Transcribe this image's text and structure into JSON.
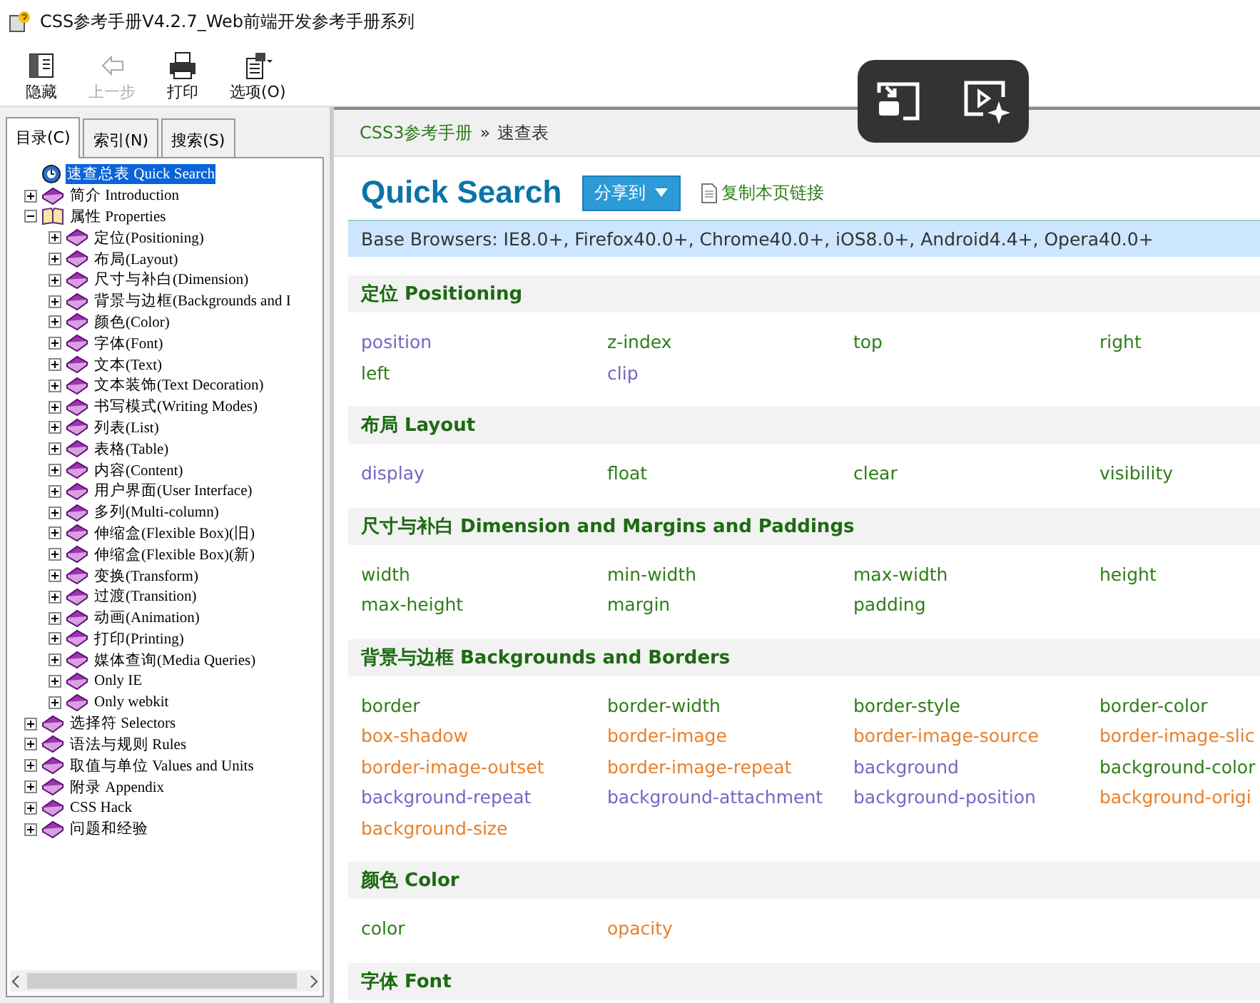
{
  "window": {
    "title": "CSS参考手册V4.2.7_Web前端开发参考手册系列"
  },
  "toolbar": [
    {
      "label": "隐藏",
      "kind": "hide",
      "disabled": false
    },
    {
      "label": "上一步",
      "kind": "back",
      "disabled": true
    },
    {
      "label": "打印",
      "kind": "print",
      "disabled": false
    },
    {
      "label": "选项(O)",
      "kind": "options",
      "disabled": false
    }
  ],
  "nav_tabs": [
    {
      "label": "目录(C)",
      "selected": true
    },
    {
      "label": "索引(N)",
      "selected": false
    },
    {
      "label": "搜索(S)",
      "selected": false
    }
  ],
  "tree": [
    {
      "label": "速查总表 Quick Search",
      "kind": "page",
      "selected": true
    },
    {
      "label": "简介 Introduction",
      "kind": "book",
      "expanded": false,
      "selected": false
    },
    {
      "label": "属性 Properties",
      "kind": "book",
      "expanded": true,
      "selected": false,
      "children": [
        {
          "label": "定位(Positioning)",
          "kind": "book",
          "expanded": false,
          "selected": false
        },
        {
          "label": "布局(Layout)",
          "kind": "book",
          "expanded": false,
          "selected": false
        },
        {
          "label": "尺寸与补白(Dimension)",
          "kind": "book",
          "expanded": false,
          "selected": false
        },
        {
          "label": "背景与边框(Backgrounds and I",
          "kind": "book",
          "expanded": false,
          "selected": false
        },
        {
          "label": "颜色(Color)",
          "kind": "book",
          "expanded": false,
          "selected": false
        },
        {
          "label": "字体(Font)",
          "kind": "book",
          "expanded": false,
          "selected": false
        },
        {
          "label": "文本(Text)",
          "kind": "book",
          "expanded": false,
          "selected": false
        },
        {
          "label": "文本装饰(Text Decoration)",
          "kind": "book",
          "expanded": false,
          "selected": false
        },
        {
          "label": "书写模式(Writing Modes)",
          "kind": "book",
          "expanded": false,
          "selected": false
        },
        {
          "label": "列表(List)",
          "kind": "book",
          "expanded": false,
          "selected": false
        },
        {
          "label": "表格(Table)",
          "kind": "book",
          "expanded": false,
          "selected": false
        },
        {
          "label": "内容(Content)",
          "kind": "book",
          "expanded": false,
          "selected": false
        },
        {
          "label": "用户界面(User Interface)",
          "kind": "book",
          "expanded": false,
          "selected": false
        },
        {
          "label": "多列(Multi-column)",
          "kind": "book",
          "expanded": false,
          "selected": false
        },
        {
          "label": "伸缩盒(Flexible Box)(旧)",
          "kind": "book",
          "expanded": false,
          "selected": false
        },
        {
          "label": "伸缩盒(Flexible Box)(新)",
          "kind": "book",
          "expanded": false,
          "selected": false
        },
        {
          "label": "变换(Transform)",
          "kind": "book",
          "expanded": false,
          "selected": false
        },
        {
          "label": "过渡(Transition)",
          "kind": "book",
          "expanded": false,
          "selected": false
        },
        {
          "label": "动画(Animation)",
          "kind": "book",
          "expanded": false,
          "selected": false
        },
        {
          "label": "打印(Printing)",
          "kind": "book",
          "expanded": false,
          "selected": false
        },
        {
          "label": "媒体查询(Media Queries)",
          "kind": "book",
          "expanded": false,
          "selected": false
        },
        {
          "label": "Only IE",
          "kind": "book",
          "expanded": false,
          "selected": false
        },
        {
          "label": "Only webkit",
          "kind": "book",
          "expanded": false,
          "selected": false
        }
      ]
    },
    {
      "label": "选择符 Selectors",
      "kind": "book",
      "expanded": false,
      "selected": false
    },
    {
      "label": "语法与规则 Rules",
      "kind": "book",
      "expanded": false,
      "selected": false
    },
    {
      "label": "取值与单位 Values and Units",
      "kind": "book",
      "expanded": false,
      "selected": false
    },
    {
      "label": "附录 Appendix",
      "kind": "book",
      "expanded": false,
      "selected": false
    },
    {
      "label": "CSS Hack",
      "kind": "book",
      "expanded": false,
      "selected": false
    },
    {
      "label": "问题和经验",
      "kind": "book",
      "expanded": false,
      "selected": false
    }
  ],
  "breadcrumb": [
    {
      "label": "CSS3参考手册",
      "kind": "link"
    },
    {
      "label": "»",
      "kind": "separator"
    },
    {
      "label": "速查表",
      "kind": "current"
    }
  ],
  "page": {
    "title": "Quick Search",
    "share_button": "分享到",
    "copy_link": "复制本页链接",
    "browsers": "Base Browsers: IE8.0+, Firefox40.0+, Chrome40.0+, iOS8.0+, Android4.4+, Opera40.0+",
    "sections": [
      {
        "title": "定位 Positioning",
        "items": [
          {
            "label": "position",
            "color": "#7566c4"
          },
          {
            "label": "z-index",
            "color": "#2e7d1a"
          },
          {
            "label": "top",
            "color": "#2e7d1a"
          },
          {
            "label": "right",
            "color": "#2e7d1a"
          },
          {
            "label": "left",
            "color": "#2e7d1a"
          },
          {
            "label": "clip",
            "color": "#7566c4"
          }
        ]
      },
      {
        "title": "布局 Layout",
        "items": [
          {
            "label": "display",
            "color": "#7566c4"
          },
          {
            "label": "float",
            "color": "#2e7d1a"
          },
          {
            "label": "clear",
            "color": "#2e7d1a"
          },
          {
            "label": "visibility",
            "color": "#2e7d1a"
          }
        ]
      },
      {
        "title": "尺寸与补白 Dimension and Margins and Paddings",
        "items": [
          {
            "label": "width",
            "color": "#2e7d1a"
          },
          {
            "label": "min-width",
            "color": "#2e7d1a"
          },
          {
            "label": "max-width",
            "color": "#2e7d1a"
          },
          {
            "label": "height",
            "color": "#2e7d1a"
          },
          {
            "label": "max-height",
            "color": "#2e7d1a"
          },
          {
            "label": "margin",
            "color": "#2e7d1a"
          },
          {
            "label": "padding",
            "color": "#2e7d1a"
          }
        ]
      },
      {
        "title": "背景与边框 Backgrounds and Borders",
        "items": [
          {
            "label": "border",
            "color": "#2e7d1a"
          },
          {
            "label": "border-width",
            "color": "#2e7d1a"
          },
          {
            "label": "border-style",
            "color": "#2e7d1a"
          },
          {
            "label": "border-color",
            "color": "#2e7d1a"
          },
          {
            "label": "box-shadow",
            "color": "#e8802c"
          },
          {
            "label": "border-image",
            "color": "#e8802c"
          },
          {
            "label": "border-image-source",
            "color": "#e8802c"
          },
          {
            "label": "border-image-slic",
            "color": "#e8802c"
          },
          {
            "label": "border-image-outset",
            "color": "#e8802c"
          },
          {
            "label": "border-image-repeat",
            "color": "#e8802c"
          },
          {
            "label": "background",
            "color": "#7566c4"
          },
          {
            "label": "background-color",
            "color": "#2e7d1a"
          },
          {
            "label": "background-repeat",
            "color": "#7566c4"
          },
          {
            "label": "background-attachment",
            "color": "#7566c4"
          },
          {
            "label": "background-position",
            "color": "#7566c4"
          },
          {
            "label": "background-origi",
            "color": "#e8802c"
          },
          {
            "label": "background-size",
            "color": "#e8802c"
          }
        ]
      },
      {
        "title": "颜色 Color",
        "items": [
          {
            "label": "color",
            "color": "#2e7d1a"
          },
          {
            "label": "opacity",
            "color": "#e8802c"
          }
        ]
      },
      {
        "title": "字体 Font"
      }
    ]
  }
}
